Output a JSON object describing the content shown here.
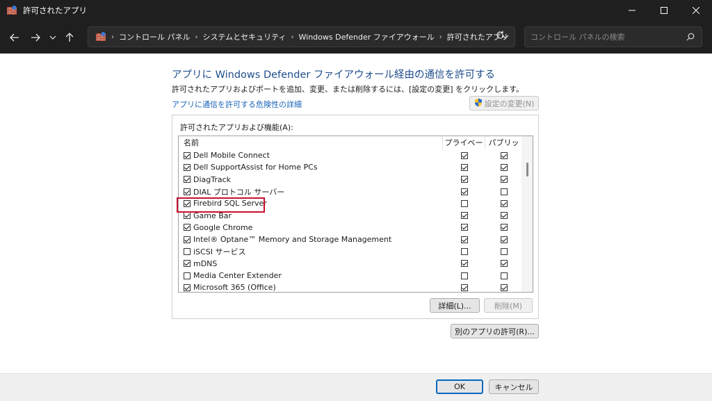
{
  "window": {
    "title": "許可されたアプリ"
  },
  "breadcrumb": {
    "items": [
      "コントロール パネル",
      "システムとセキュリティ",
      "Windows Defender ファイアウォール",
      "許可されたアプリ"
    ],
    "separator": "›",
    "first_separator": "›"
  },
  "search": {
    "placeholder": "コントロール パネルの検索"
  },
  "main": {
    "heading": "アプリに Windows Defender ファイアウォール経由の通信を許可する",
    "description": "許可されたアプリおよびポートを追加、変更、または削除するには、[設定の変更] をクリックします。",
    "risk_link": "アプリに通信を許可する危険性の詳細",
    "change_settings": "設定の変更(N)",
    "group_label": "許可されたアプリおよび機能(A):",
    "columns": {
      "name": "名前",
      "private": "プライベート",
      "public": "パブリック"
    },
    "apps": [
      {
        "name": "Dell Mobile Connect",
        "enabled": true,
        "private": true,
        "public": true
      },
      {
        "name": "Dell SupportAssist for Home PCs",
        "enabled": true,
        "private": true,
        "public": true
      },
      {
        "name": "DiagTrack",
        "enabled": true,
        "private": true,
        "public": true
      },
      {
        "name": "DIAL プロトコル サーバー",
        "enabled": true,
        "private": true,
        "public": false
      },
      {
        "name": "Firebird SQL Server",
        "enabled": true,
        "private": false,
        "public": true
      },
      {
        "name": "Game Bar",
        "enabled": true,
        "private": true,
        "public": true
      },
      {
        "name": "Google Chrome",
        "enabled": true,
        "private": true,
        "public": true
      },
      {
        "name": "Intel® Optane™ Memory and Storage Management",
        "enabled": true,
        "private": true,
        "public": true
      },
      {
        "name": "iSCSI サービス",
        "enabled": false,
        "private": false,
        "public": false
      },
      {
        "name": "mDNS",
        "enabled": true,
        "private": true,
        "public": true
      },
      {
        "name": "Media Center Extender",
        "enabled": false,
        "private": false,
        "public": false
      },
      {
        "name": "Microsoft 365 (Office)",
        "enabled": true,
        "private": true,
        "public": true
      }
    ],
    "details_button": "詳細(L)...",
    "remove_button": "削除(M)",
    "allow_other_button": "別のアプリの許可(R)..."
  },
  "footer": {
    "ok": "OK",
    "cancel": "キャンセル"
  },
  "colors": {
    "accent_red": "#c8102e",
    "link_blue": "#1a64b8",
    "heading_blue": "#1e4e8c",
    "chrome_dark": "#1f1f1f"
  }
}
